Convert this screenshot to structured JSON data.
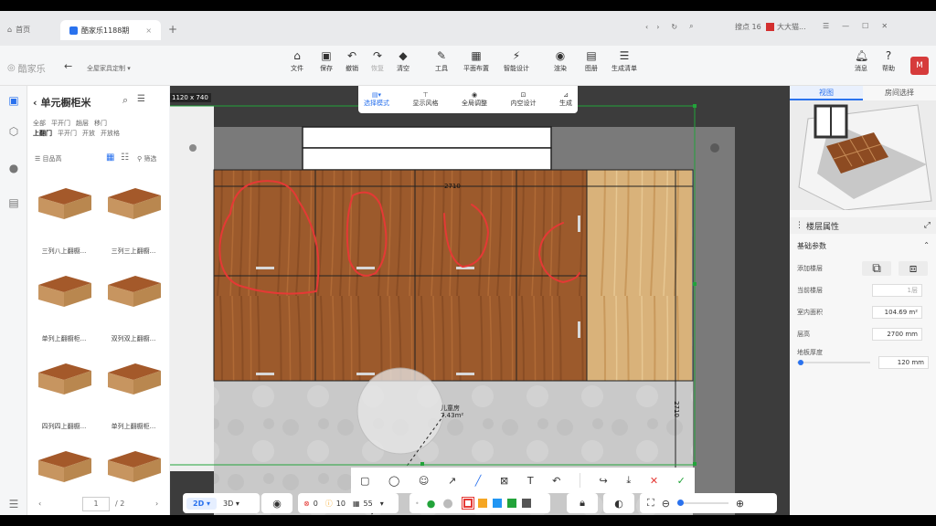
{
  "browser": {
    "tabs": [
      {
        "label": "首页"
      },
      {
        "label": "酷家乐1188期"
      }
    ],
    "new_tab": "+",
    "right_items": [
      "搜点 16",
      "大大猫..."
    ]
  },
  "header": {
    "logo": "酷家乐",
    "back": "←",
    "breadcrumb": "全屋家具定制",
    "tools": [
      {
        "label": "文件",
        "icon": "file-icon"
      },
      {
        "label": "保存",
        "icon": "save-icon"
      },
      {
        "label": "撤销",
        "icon": "undo-icon"
      },
      {
        "label": "恢复",
        "icon": "redo-icon"
      },
      {
        "label": "清空",
        "icon": "eraser-icon"
      },
      {
        "label": "工具",
        "icon": "wrench-icon"
      },
      {
        "label": "平面布置",
        "icon": "layout-icon"
      },
      {
        "label": "智能设计",
        "icon": "smart-icon"
      },
      {
        "label": "渲染",
        "icon": "camera-icon"
      },
      {
        "label": "图册",
        "icon": "album-icon"
      },
      {
        "label": "生成清单",
        "icon": "list-icon"
      }
    ],
    "right_tools": [
      {
        "label": "消息"
      },
      {
        "label": "帮助"
      }
    ]
  },
  "sub_toolbar": {
    "items": [
      {
        "label": "选择模式"
      },
      {
        "label": "显示风格"
      },
      {
        "label": "全局调整"
      },
      {
        "label": "内空设计"
      },
      {
        "label": "生成"
      }
    ]
  },
  "library": {
    "title": "单元橱柜米",
    "dimension": "1120 x 740",
    "filters_row1": [
      "全部",
      "平开门",
      "趟层",
      "移门"
    ],
    "filters_row2": [
      "上翻门",
      "平开门",
      "开放",
      "开放格"
    ],
    "sort_label": "目品高",
    "filter_label": "筛选",
    "items": [
      {
        "label": "三列八上翻橱..."
      },
      {
        "label": "三列三上翻橱..."
      },
      {
        "label": "单列上翻橱柜..."
      },
      {
        "label": "双列双上翻橱..."
      },
      {
        "label": "四列四上翻橱..."
      },
      {
        "label": "单列上翻橱柜..."
      },
      {
        "label": ""
      },
      {
        "label": ""
      }
    ],
    "page_current": "1",
    "page_total": "/ 2"
  },
  "canvas": {
    "dim_top": "2710",
    "dim_side": "2710",
    "room_label": "儿童房",
    "room_area": "7.43m²"
  },
  "right_panel": {
    "tabs": [
      {
        "label": "视图"
      },
      {
        "label": "房间选择"
      }
    ],
    "section_title": "楼层属性",
    "basic_params": "基础参数",
    "rows": [
      {
        "label": "添加楼层",
        "value": ""
      },
      {
        "label": "当前楼层",
        "value": "1层"
      },
      {
        "label": "室内面积",
        "value": "104.69 m²"
      },
      {
        "label": "层高",
        "value": "2700 mm"
      },
      {
        "label": "地板厚度",
        "value": "120 mm"
      }
    ],
    "slider_value": 0.05
  },
  "bottom_bar": {
    "view_2d": "2D",
    "view_3d": "3D",
    "errors": "0",
    "warnings": "10",
    "items": "55"
  },
  "annot_toolbar": {
    "colors": [
      "#e53935",
      "#f5a623",
      "#2196f3",
      "#22a33a",
      "#555555"
    ],
    "selected_color": "#e53935"
  }
}
